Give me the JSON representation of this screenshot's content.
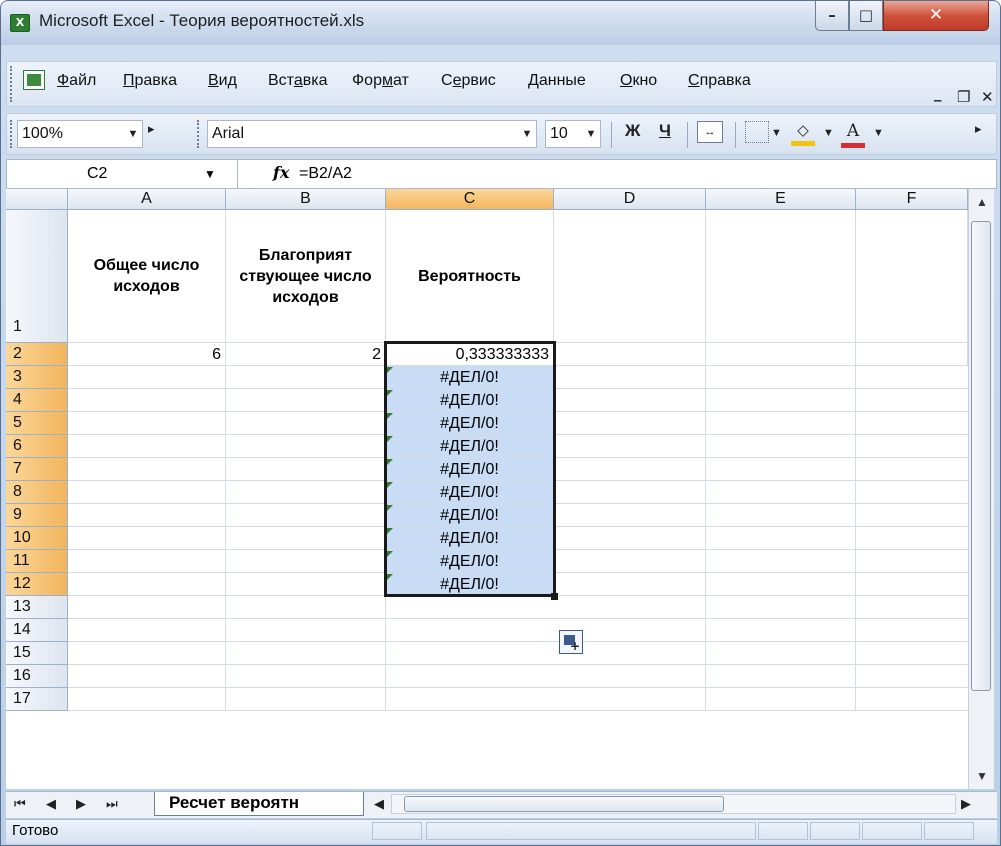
{
  "window": {
    "title": "Microsoft Excel - Теория вероятностей.xls",
    "icon": "excel-icon"
  },
  "menu": {
    "items": [
      {
        "id": "file",
        "label": "Файл"
      },
      {
        "id": "edit",
        "label": "Правка"
      },
      {
        "id": "view",
        "label": "Вид"
      },
      {
        "id": "insert",
        "label": "Вставка"
      },
      {
        "id": "format",
        "label": "Формат"
      },
      {
        "id": "tools",
        "label": "Сервис"
      },
      {
        "id": "data",
        "label": "Данные"
      },
      {
        "id": "window",
        "label": "Окно"
      },
      {
        "id": "help",
        "label": "Справка"
      }
    ]
  },
  "toolbar": {
    "zoom": "100%",
    "font": "Arial",
    "font_size": "10",
    "bold_label": "Ж",
    "underline_label": "Ч"
  },
  "formula_bar": {
    "cell_ref": "C2",
    "fx_label": "fx",
    "formula": "=B2/A2"
  },
  "sheet": {
    "columns": [
      "A",
      "B",
      "C",
      "D",
      "E",
      "F"
    ],
    "selected_column": "C",
    "rows": [
      "1",
      "2",
      "3",
      "4",
      "5",
      "6",
      "7",
      "8",
      "9",
      "10",
      "11",
      "12",
      "13",
      "14",
      "15",
      "16",
      "17"
    ],
    "headers": {
      "a1": "Общее число исходов",
      "b1": "Благоприят ствующее число исходов",
      "c1": "Вероятность"
    },
    "a2": "6",
    "b2": "2",
    "c2": "0,333333333",
    "error_value": "#ДЕЛ/0!",
    "error_rows": [
      "3",
      "4",
      "5",
      "6",
      "7",
      "8",
      "9",
      "10",
      "11",
      "12"
    ],
    "selection": "C2:C12"
  },
  "tabs": {
    "active": "Ресчет вероятн"
  },
  "status": {
    "text": "Готово"
  },
  "colors": {
    "selected_fill": "#c8dcf5",
    "header_selected": "#f2b55d",
    "error_indicator": "#2e7d32"
  }
}
